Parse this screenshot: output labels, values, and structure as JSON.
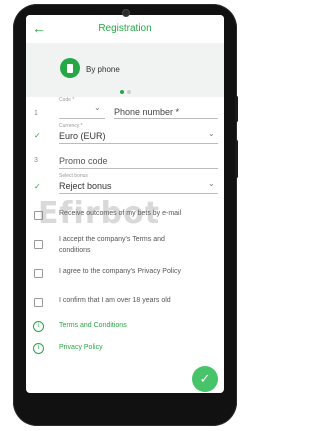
{
  "header": {
    "title": "Registration",
    "back": "←"
  },
  "hero": {
    "method": "By phone"
  },
  "form": {
    "code": {
      "index": "1",
      "label": "Code *",
      "value": ""
    },
    "phone": {
      "placeholder": "Phone number *"
    },
    "currency": {
      "label": "Currency *",
      "value": "Euro (EUR)"
    },
    "promo": {
      "index": "3",
      "placeholder": "Promo code"
    },
    "bonus": {
      "label": "Select bonus",
      "value": "Reject bonus"
    }
  },
  "checks": [
    {
      "text": "Receive outcomes of my bets by e-mail"
    },
    {
      "text": "I accept the company's Terms and conditions"
    },
    {
      "text": "I agree to the company's Privacy Policy"
    },
    {
      "text": "I confirm that I am over 18 years old"
    }
  ],
  "links": [
    {
      "text": "Terms and Conditions"
    },
    {
      "text": "Privacy Policy"
    }
  ],
  "watermark": "Efirbot",
  "colors": {
    "accent": "#26a745",
    "fab": "#47c46a"
  },
  "icons": {
    "checkmark": "✓",
    "chevron": "⌄",
    "info": "i"
  }
}
